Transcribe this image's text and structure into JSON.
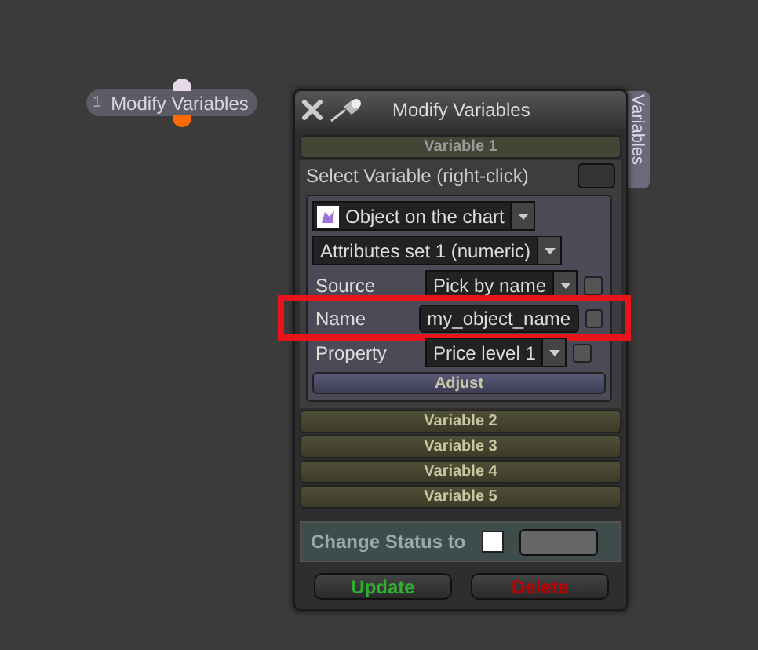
{
  "node": {
    "number": "1",
    "label": "Modify Variables"
  },
  "dialog": {
    "title": "Modify Variables",
    "side_tab": "Variables",
    "variables": [
      {
        "label": "Variable 1",
        "expanded": true
      },
      {
        "label": "Variable 2",
        "expanded": false
      },
      {
        "label": "Variable 3",
        "expanded": false
      },
      {
        "label": "Variable 4",
        "expanded": false
      },
      {
        "label": "Variable 5",
        "expanded": false
      }
    ],
    "select_label": "Select Variable (right-click)",
    "object_dropdown": "Object on the chart",
    "attributes_dropdown": "Attributes set 1 (numeric)",
    "fields": [
      {
        "kind": "dropdown",
        "label": "Source",
        "value": "Pick by name",
        "checked": false,
        "highlighted": false
      },
      {
        "kind": "text",
        "label": "Name",
        "value": "my_object_name",
        "checked": false,
        "highlighted": true
      },
      {
        "kind": "dropdown",
        "label": "Property",
        "value": "Price level 1",
        "checked": false,
        "highlighted": false
      }
    ],
    "adjust_button": "Adjust",
    "change_status": {
      "label": "Change Status to",
      "checked": false
    },
    "buttons": [
      {
        "label": "Update",
        "color": "#2fae2f"
      },
      {
        "label": "Delete",
        "color": "#c00000"
      }
    ]
  }
}
